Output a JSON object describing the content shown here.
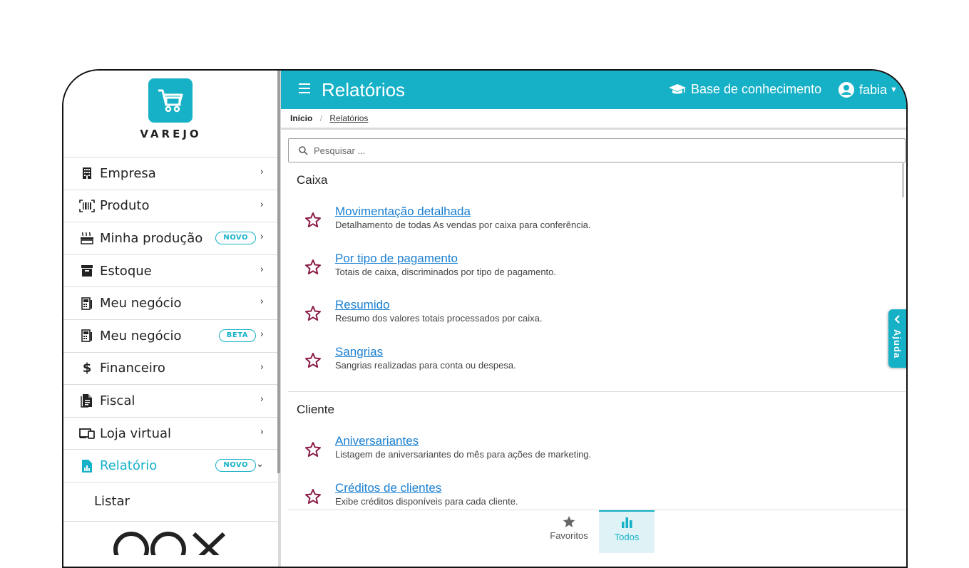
{
  "brand": {
    "name": "VAREJO",
    "accent": "#16b1c7"
  },
  "sidebar": {
    "items": [
      {
        "label": "Empresa",
        "icon": "building-icon"
      },
      {
        "label": "Produto",
        "icon": "barcode-icon"
      },
      {
        "label": "Minha produção",
        "icon": "production-icon",
        "badge": "NOVO"
      },
      {
        "label": "Estoque",
        "icon": "archive-icon"
      },
      {
        "label": "Meu negócio",
        "icon": "cash-register-icon"
      },
      {
        "label": "Meu negócio",
        "icon": "cash-register-icon",
        "badge": "BETA"
      },
      {
        "label": "Financeiro",
        "icon": "dollar-icon"
      },
      {
        "label": "Fiscal",
        "icon": "document-icon"
      },
      {
        "label": "Loja virtual",
        "icon": "devices-icon"
      },
      {
        "label": "Relatório",
        "icon": "report-icon",
        "badge": "NOVO",
        "active": true
      }
    ],
    "submenu": [
      {
        "label": "Listar"
      }
    ]
  },
  "header": {
    "title": "Relatórios",
    "knowledge_base": "Base de conhecimento",
    "user": "fabia"
  },
  "breadcrumb": {
    "home": "Início",
    "current": "Relatórios"
  },
  "search": {
    "placeholder": "Pesquisar ..."
  },
  "sections": [
    {
      "title": "Caixa",
      "reports": [
        {
          "title": "Movimentação detalhada",
          "description": "Detalhamento de todas As vendas por caixa para conferência."
        },
        {
          "title": "Por tipo de pagamento",
          "description": "Totais de caixa, discriminados por tipo de pagamento."
        },
        {
          "title": "Resumido",
          "description": "Resumo dos valores totais processados por caixa."
        },
        {
          "title": "Sangrias",
          "description": "Sangrias realizadas para conta ou despesa."
        }
      ]
    },
    {
      "title": "Cliente",
      "reports": [
        {
          "title": "Aniversariantes",
          "description": "Listagem de aniversariantes do mês para ações de marketing."
        },
        {
          "title": "Créditos de clientes",
          "description": "Exibe créditos disponíveis para cada cliente."
        }
      ]
    }
  ],
  "tabs": {
    "favorites": "Favoritos",
    "all": "Todos"
  },
  "help": {
    "label": "Ajuda"
  }
}
